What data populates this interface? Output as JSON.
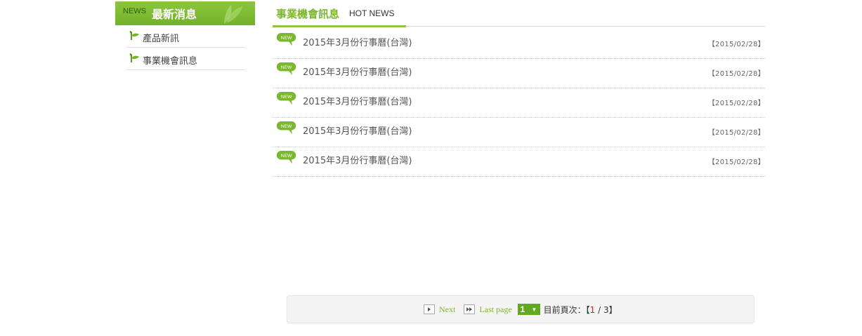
{
  "sidebar": {
    "title_en": "NEWS",
    "title_zh": "最新消息",
    "items": [
      {
        "label": "產品新訊"
      },
      {
        "label": "事業機會訊息"
      }
    ]
  },
  "main": {
    "title_zh": "事業機會訊息",
    "title_en": "HOT NEWS",
    "news": [
      {
        "badge": "NEW",
        "title": "2015年3月份行事曆(台灣)",
        "date": "【2015/02/28】"
      },
      {
        "badge": "NEW",
        "title": "2015年3月份行事曆(台灣)",
        "date": "【2015/02/28】"
      },
      {
        "badge": "NEW",
        "title": "2015年3月份行事曆(台灣)",
        "date": "【2015/02/28】"
      },
      {
        "badge": "NEW",
        "title": "2015年3月份行事曆(台灣)",
        "date": "【2015/02/28】"
      },
      {
        "badge": "NEW",
        "title": "2015年3月份行事曆(台灣)",
        "date": "【2015/02/28】"
      }
    ]
  },
  "pager": {
    "next_label": "Next",
    "last_label": "Last page",
    "selected_page": "1",
    "current_label": "目前頁次：【",
    "current_page": "1",
    "separator": " / ",
    "total_pages": "3",
    "close_bracket": "】"
  },
  "colors": {
    "accent_green": "#8cc63f",
    "current_page_red": "#d21f1f"
  }
}
